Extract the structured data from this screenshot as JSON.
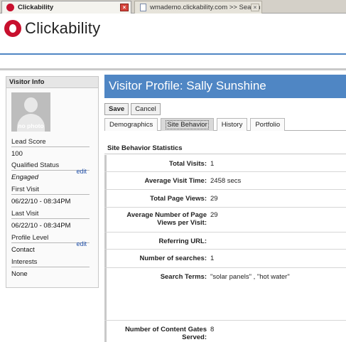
{
  "browser": {
    "tabs": [
      {
        "label": "Clickability",
        "close": "×"
      },
      {
        "label": "wmademo.clickability.com >> Search",
        "close": "×"
      }
    ]
  },
  "header": {
    "logo_text": "Clickability"
  },
  "sidebar": {
    "title": "Visitor Info",
    "avatar_text": "no photo",
    "fields": [
      {
        "label": "Lead Score",
        "value": "100"
      },
      {
        "label": "Qualified Status",
        "value": "Engaged",
        "edit": "edit"
      },
      {
        "label": "First Visit",
        "value": "06/22/10 - 08:34PM"
      },
      {
        "label": "Last Visit",
        "value": "06/22/10 - 08:34PM"
      },
      {
        "label": "Profile Level",
        "value": "Contact",
        "edit": "edit"
      },
      {
        "label": "Interests",
        "value": "None"
      }
    ]
  },
  "main": {
    "title": "Visitor Profile: Sally Sunshine",
    "buttons": {
      "save": "Save",
      "cancel": "Cancel"
    },
    "tabs": [
      "Demographics",
      "Site Behavior",
      "History",
      "Portfolio"
    ],
    "selected_tab": "Site Behavior",
    "section_title": "Site Behavior Statistics",
    "stats": [
      {
        "label": "Total Visits:",
        "value": "1"
      },
      {
        "label": "Average Visit Time:",
        "value": "2458 secs"
      },
      {
        "label": "Total Page Views:",
        "value": "29"
      },
      {
        "label": "Average Number of Page Views per Visit:",
        "value": "29"
      },
      {
        "label": "Referring URL:",
        "value": ""
      },
      {
        "label": "Number of searches:",
        "value": "1"
      },
      {
        "label": "Search Terms:",
        "value": "\"solar panels\" , \"hot water\""
      },
      {
        "label": "Number of Content Gates Served:",
        "value": "8"
      }
    ]
  },
  "colors": {
    "brand_red": "#c8102e",
    "header_blue": "#4f86c4",
    "link_blue": "#1f4fa8"
  }
}
